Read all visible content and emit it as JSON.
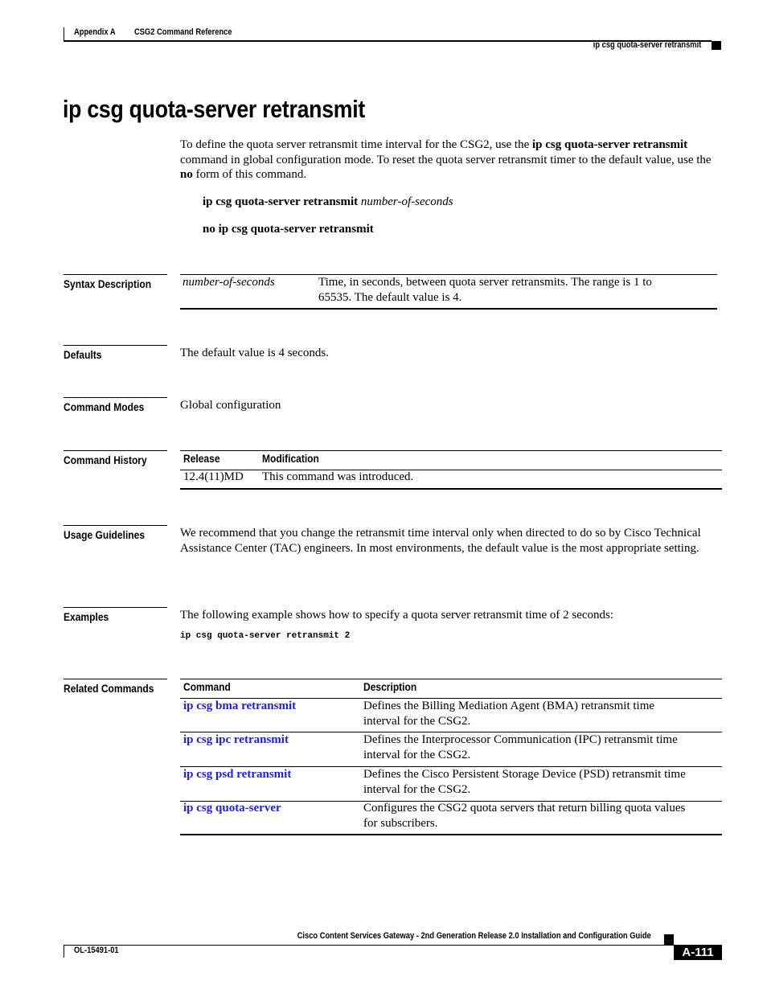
{
  "header": {
    "appendix": "Appendix A",
    "chapter": "CSG2 Command Reference",
    "running_title": "ip csg quota-server retransmit"
  },
  "title": "ip csg quota-server retransmit",
  "intro": {
    "part1": "To define the quota server retransmit time interval for the CSG2, use the ",
    "cmd": "ip csg quota-server retransmit",
    "part2": " command in global configuration mode. To reset the quota server retransmit timer to the default value, use the ",
    "no": "no",
    "part3": " form of this command."
  },
  "syntax": {
    "line1_cmd": "ip csg quota-server retransmit",
    "line1_arg": "number-of-seconds",
    "line2_cmd": "no ip csg quota-server retransmit"
  },
  "sections": {
    "syntax_description": {
      "label": "Syntax Description",
      "rows": [
        {
          "param": "number-of-seconds",
          "desc": "Time, in seconds, between quota server retransmits. The range is 1 to 65535. The default value is 4."
        }
      ]
    },
    "defaults": {
      "label": "Defaults",
      "text": "The default value is 4 seconds."
    },
    "command_modes": {
      "label": "Command Modes",
      "text": "Global configuration"
    },
    "command_history": {
      "label": "Command History",
      "headers": [
        "Release",
        "Modification"
      ],
      "rows": [
        {
          "release": "12.4(11)MD",
          "modification": "This command was introduced."
        }
      ]
    },
    "usage_guidelines": {
      "label": "Usage Guidelines",
      "text": "We recommend that you change the retransmit time interval only when directed to do so by Cisco Technical Assistance Center (TAC) engineers. In most environments, the default value is the most appropriate setting."
    },
    "examples": {
      "label": "Examples",
      "text": "The following example shows how to specify a quota server retransmit time of 2 seconds:",
      "code": "ip csg quota-server retransmit 2"
    },
    "related_commands": {
      "label": "Related Commands",
      "headers": [
        "Command",
        "Description"
      ],
      "rows": [
        {
          "command": "ip csg bma retransmit",
          "desc_l1": "Defines the Billing Mediation Agent (BMA) retransmit time",
          "desc_l2": "interval for the CSG2."
        },
        {
          "command": "ip csg ipc retransmit",
          "desc_l1": "Defines the Interprocessor Communication (IPC) retransmit time",
          "desc_l2": "interval for the CSG2."
        },
        {
          "command": "ip csg psd retransmit",
          "desc_l1": "Defines the Cisco Persistent Storage Device (PSD) retransmit time",
          "desc_l2": "interval for the CSG2."
        },
        {
          "command": "ip csg quota-server",
          "desc_l1": "Configures the CSG2 quota servers that return billing quota values",
          "desc_l2": "for subscribers."
        }
      ]
    }
  },
  "footer": {
    "guide_title": "Cisco Content Services Gateway - 2nd Generation Release 2.0 Installation and Configuration Guide",
    "doc_number": "OL-15491-01",
    "page_number": "A-111"
  },
  "colors": {
    "link": "#1a1aff",
    "text": "#000000"
  }
}
